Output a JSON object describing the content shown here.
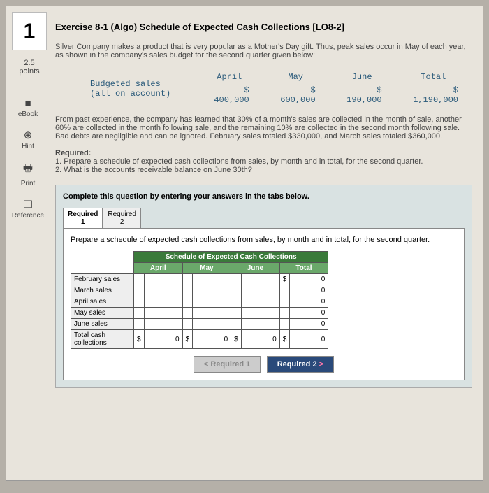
{
  "question_number": "1",
  "points_value": "2.5",
  "points_label": "points",
  "sidebar": [
    {
      "icon": "■",
      "label": "eBook"
    },
    {
      "icon": "⊕",
      "label": "Hint"
    },
    {
      "icon": "🖶",
      "label": "Print"
    },
    {
      "icon": "❑",
      "label": "Reference"
    }
  ],
  "title": "Exercise 8-1 (Algo) Schedule of Expected Cash Collections [LO8-2]",
  "intro": "Silver Company makes a product that is very popular as a Mother's Day gift. Thus, peak sales occur in May of each year, as shown in the company's sales budget for the second quarter given below:",
  "budget": {
    "row_label": "Budgeted sales (all on account)",
    "cols": [
      "April",
      "May",
      "June",
      "Total"
    ],
    "vals": [
      "$ 400,000",
      "$ 600,000",
      "$ 190,000",
      "$ 1,190,000"
    ]
  },
  "experience": "From past experience, the company has learned that 30% of a month's sales are collected in the month of sale, another 60% are collected in the month following sale, and the remaining 10% are collected in the second month following sale. Bad debts are negligible and can be ignored. February sales totaled $330,000, and March sales totaled $360,000.",
  "required_label": "Required:",
  "required_items": [
    "1. Prepare a schedule of expected cash collections from sales, by month and in total, for the second quarter.",
    "2. What is the accounts receivable balance on June 30th?"
  ],
  "answer_instr": "Complete this question by entering your answers in the tabs below.",
  "tabs": {
    "t1a": "Required",
    "t1b": "1",
    "t2a": "Required",
    "t2b": "2"
  },
  "sched_intro": "Prepare a schedule of expected cash collections from sales, by month and in total, for the second quarter.",
  "sched_title": "Schedule of Expected Cash Collections",
  "sched_cols": [
    "April",
    "May",
    "June",
    "Total"
  ],
  "sched_rows": [
    "February sales",
    "March sales",
    "April sales",
    "May sales",
    "June sales",
    "Total cash collections"
  ],
  "chart_data": {
    "type": "table",
    "title": "Schedule of Expected Cash Collections",
    "columns": [
      "",
      "April",
      "May",
      "June",
      "Total"
    ],
    "rows": [
      [
        "February sales",
        "",
        "",
        "",
        "$ 0"
      ],
      [
        "March sales",
        "",
        "",
        "",
        "0"
      ],
      [
        "April sales",
        "",
        "",
        "",
        "0"
      ],
      [
        "May sales",
        "",
        "",
        "",
        "0"
      ],
      [
        "June sales",
        "",
        "",
        "",
        "0"
      ],
      [
        "Total cash collections",
        "$ 0",
        "$ 0",
        "$ 0",
        "$ 0"
      ]
    ]
  },
  "cur": "$",
  "zero": "0",
  "nav": {
    "prev": "Required 1",
    "next": "Required 2",
    "lt": "<",
    "gt": ">"
  }
}
